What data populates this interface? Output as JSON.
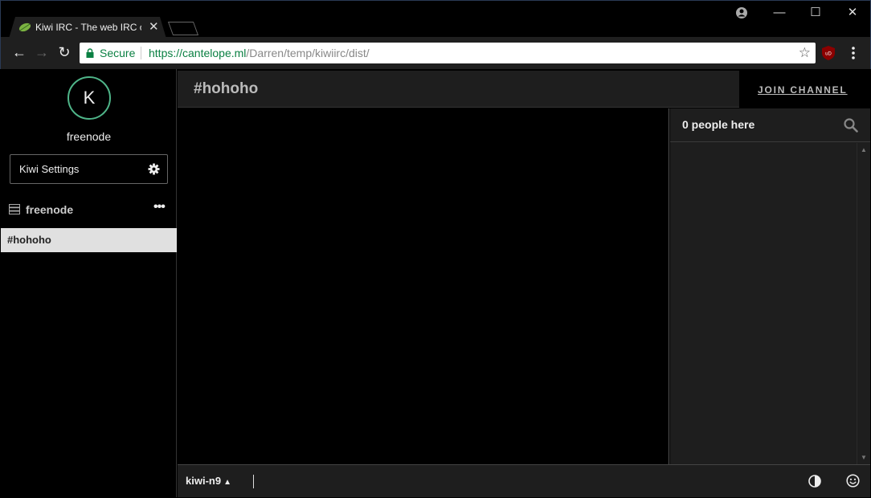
{
  "browser": {
    "tab_title": "Kiwi IRC - The web IRC client",
    "secure_label": "Secure",
    "url_host": "https://cantelope.ml",
    "url_path": "/Darren/temp/kiwiirc/dist/",
    "ext_badge": "uD"
  },
  "sidebar": {
    "avatar_letter": "K",
    "network_name": "freenode",
    "settings_label": "Kiwi Settings",
    "network_row_label": "freenode",
    "more_label": "•••",
    "channels": [
      {
        "label": "#hohoho",
        "active": true
      }
    ]
  },
  "header": {
    "channel_name": "#hohoho",
    "join_label": "JOIN CHANNEL"
  },
  "userlist": {
    "count_label": "0 people here"
  },
  "input": {
    "nick": "kiwi-n9",
    "value": ""
  },
  "colors": {
    "accent": "#4fb589",
    "background": "#000000",
    "panel": "#1e1e1e",
    "active_channel_bg": "#e0e0e0"
  }
}
